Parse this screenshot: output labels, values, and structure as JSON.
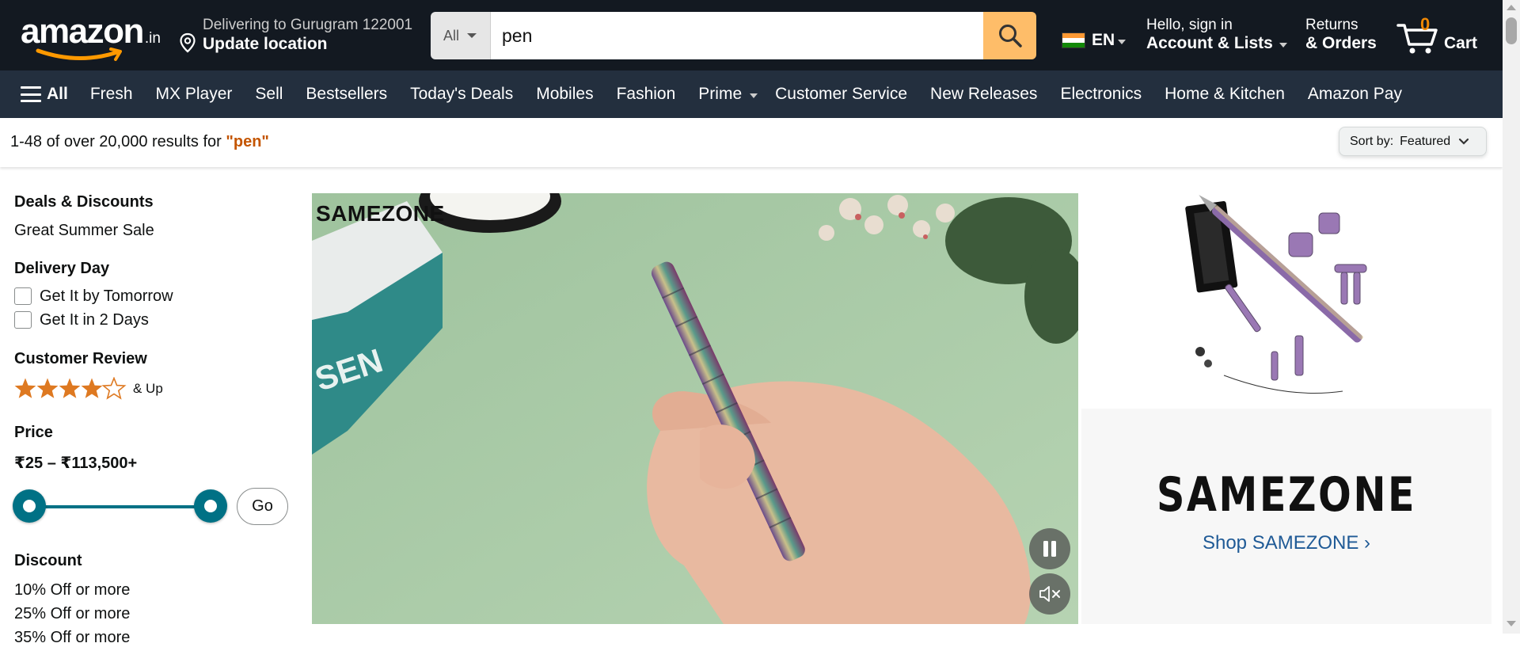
{
  "header": {
    "logo_text": "amazon",
    "logo_tld": ".in",
    "location_line1": "Delivering to Gurugram 122001",
    "location_line2": "Update location",
    "search_category": "All",
    "search_value": "pen",
    "language": "EN",
    "account_line1": "Hello, sign in",
    "account_line2": "Account & Lists",
    "returns_line1": "Returns",
    "returns_line2": "& Orders",
    "cart_count": "0",
    "cart_label": "Cart"
  },
  "subnav": {
    "all_label": "All",
    "items": [
      "Fresh",
      "MX Player",
      "Sell",
      "Bestsellers",
      "Today's Deals",
      "Mobiles",
      "Fashion",
      "Prime",
      "Customer Service",
      "New Releases",
      "Electronics",
      "Home & Kitchen",
      "Amazon Pay"
    ]
  },
  "results": {
    "prefix": "1-48 of over 20,000 results for ",
    "query": "\"pen\"",
    "sort_label": "Sort by:",
    "sort_value": "Featured"
  },
  "sidebar": {
    "deals_heading": "Deals & Discounts",
    "deals_item": "Great Summer Sale",
    "delivery_heading": "Delivery Day",
    "delivery_options": [
      "Get It by Tomorrow",
      "Get It in 2 Days"
    ],
    "review_heading": "Customer Review",
    "review_rating": 4,
    "review_suffix": "& Up",
    "price_heading": "Price",
    "price_range": "₹25 – ₹113,500+",
    "go_label": "Go",
    "discount_heading": "Discount",
    "discount_options": [
      "10% Off or more",
      "25% Off or more",
      "35% Off or more"
    ]
  },
  "banner": {
    "video_brand": "SAMEZONE",
    "ad_brand": "SAMEZONE",
    "ad_link": "Shop SAMEZONE ›"
  },
  "colors": {
    "nav_dark": "#131921",
    "nav_sub": "#232f3e",
    "accent_orange": "#febd69",
    "query_orange": "#c45500",
    "slider_teal": "#007185",
    "link_blue": "#1f5a96",
    "star_orange": "#de7921"
  }
}
